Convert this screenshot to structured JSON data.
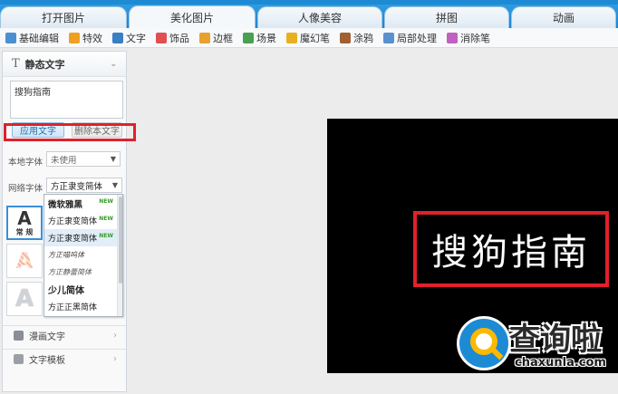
{
  "tabs": [
    {
      "label": "打开图片",
      "active": false
    },
    {
      "label": "美化图片",
      "active": true
    },
    {
      "label": "人像美容",
      "active": false
    },
    {
      "label": "拼图",
      "active": false
    },
    {
      "label": "动画",
      "active": false
    }
  ],
  "toolbar": [
    {
      "label": "基础编辑",
      "icon": "basic-edit-icon",
      "color": "#4a8fcf"
    },
    {
      "label": "特效",
      "icon": "effects-icon",
      "color": "#f0a020"
    },
    {
      "label": "文字",
      "icon": "text-icon",
      "color": "#3a7fc2"
    },
    {
      "label": "饰品",
      "icon": "accessory-icon",
      "color": "#e05050"
    },
    {
      "label": "边框",
      "icon": "frame-icon",
      "color": "#e8a030"
    },
    {
      "label": "场景",
      "icon": "scene-icon",
      "color": "#4aa050"
    },
    {
      "label": "魔幻笔",
      "icon": "magic-pen-icon",
      "color": "#e8b020"
    },
    {
      "label": "涂鸦",
      "icon": "doodle-icon",
      "color": "#a06030"
    },
    {
      "label": "局部处理",
      "icon": "local-process-icon",
      "color": "#5a90d0"
    },
    {
      "label": "消除笔",
      "icon": "eraser-pen-icon",
      "color": "#c060c0"
    }
  ],
  "panel": {
    "title": "静态文字",
    "textbox_value": "搜狗指南",
    "apply_button": "应用文字",
    "delete_button": "删除本文字",
    "local_font_label": "本地字体",
    "local_font_value": "未使用",
    "web_font_label": "网络字体",
    "web_font_value": "方正隶变简体",
    "thumb_label": "常 规",
    "dropdown": [
      {
        "label": "微软雅黑",
        "badge": "NEW"
      },
      {
        "label": "方正隶变简体",
        "badge": "NEW"
      },
      {
        "label": "方正隶变简体",
        "badge": "NEW"
      },
      {
        "label": "方正喵呜体",
        "badge": ""
      },
      {
        "label": "方正静蕾简体",
        "badge": ""
      },
      {
        "label": "少儿简体",
        "badge": ""
      },
      {
        "label": "方正正黑简体",
        "badge": ""
      }
    ],
    "bottom_rows": [
      "漫画文字",
      "文字模板"
    ]
  },
  "canvas": {
    "caption": "搜狗指南"
  },
  "watermark": {
    "text": "查询啦",
    "url": "chaxunla.com"
  }
}
